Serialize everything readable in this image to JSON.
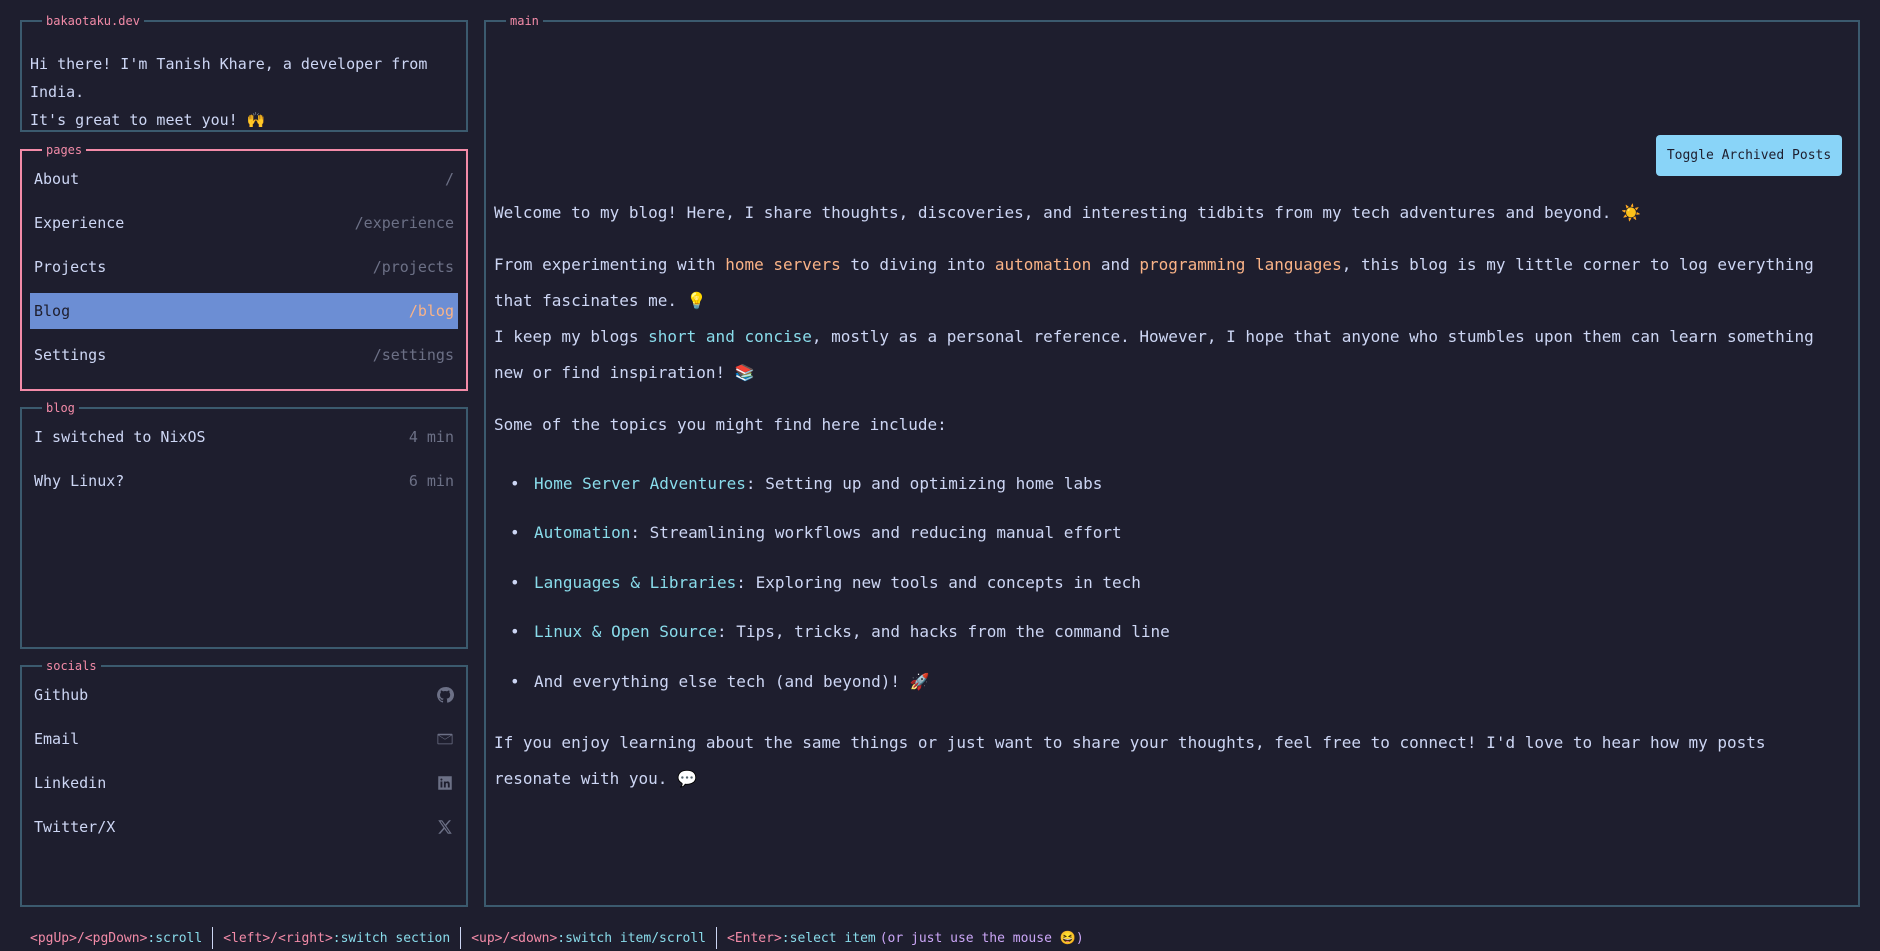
{
  "intro": {
    "title": "bakaotaku.dev",
    "line1": "Hi there! I'm Tanish Khare, a developer from India.",
    "line2": "It's great to meet you! 🙌"
  },
  "pages": {
    "title": "pages",
    "items": [
      {
        "label": "About",
        "path": "/"
      },
      {
        "label": "Experience",
        "path": "/experience"
      },
      {
        "label": "Projects",
        "path": "/projects"
      },
      {
        "label": "Blog",
        "path": "/blog"
      },
      {
        "label": "Settings",
        "path": "/settings"
      }
    ],
    "selected": "Blog"
  },
  "blog": {
    "title": "blog",
    "posts": [
      {
        "title": "I switched to NixOS",
        "read_time": "4 min"
      },
      {
        "title": "Why Linux?",
        "read_time": "6 min"
      }
    ]
  },
  "socials": {
    "title": "socials",
    "items": [
      {
        "label": "Github",
        "icon": "github-icon"
      },
      {
        "label": "Email",
        "icon": "email-icon"
      },
      {
        "label": "Linkedin",
        "icon": "linkedin-icon"
      },
      {
        "label": "Twitter/X",
        "icon": "x-icon"
      }
    ]
  },
  "main": {
    "title": "main",
    "toggle_label": "Toggle Archived Posts",
    "welcome": "Welcome to my blog! Here, I share thoughts, discoveries, and interesting tidbits from my tech adventures and beyond. ☀️",
    "p2": {
      "a": "From experimenting with ",
      "hl1": "home servers",
      "b": " to diving into ",
      "hl2": "automation",
      "c": " and ",
      "hl3": "programming languages",
      "d": ", this blog is my little corner to log everything that fascinates me. 💡"
    },
    "p3": {
      "a": "I keep my blogs ",
      "hl": "short and concise",
      "b": ", mostly as a personal reference. However, I hope that anyone who stumbles upon them can learn something new or find inspiration! 📚"
    },
    "topics_intro": "Some of the topics you might find here include:",
    "topics": [
      {
        "name": "Home Server Adventures",
        "desc": ": Setting up and optimizing home labs"
      },
      {
        "name": "Automation",
        "desc": ": Streamlining workflows and reducing manual effort"
      },
      {
        "name": "Languages & Libraries",
        "desc": ": Exploring new tools and concepts in tech"
      },
      {
        "name": "Linux & Open Source",
        "desc": ": Tips, tricks, and hacks from the command line"
      },
      {
        "name": "",
        "desc": "And everything else tech (and beyond)! 🚀"
      }
    ],
    "closing": "If you enjoy learning about the same things or just want to share your thoughts, feel free to connect! I'd love to hear how my posts resonate with you. 💬"
  },
  "statusbar": {
    "items": [
      {
        "key": "<pgUp>/<pgDown>",
        "desc": ":scroll"
      },
      {
        "key": "<left>/<right>",
        "desc": ":switch section"
      },
      {
        "key": "<up>/<down>",
        "desc": ":switch item/scroll"
      },
      {
        "key": "<Enter>",
        "desc": ":select item"
      }
    ],
    "hint": "(or just use the mouse 😆)"
  },
  "colors": {
    "background": "#1e1e2e",
    "accent_pink": "#f38ba8",
    "accent_orange": "#fab387",
    "accent_blue": "#89dceb",
    "selected_bg": "#6c8ed4",
    "border": "#3b5a6e"
  }
}
